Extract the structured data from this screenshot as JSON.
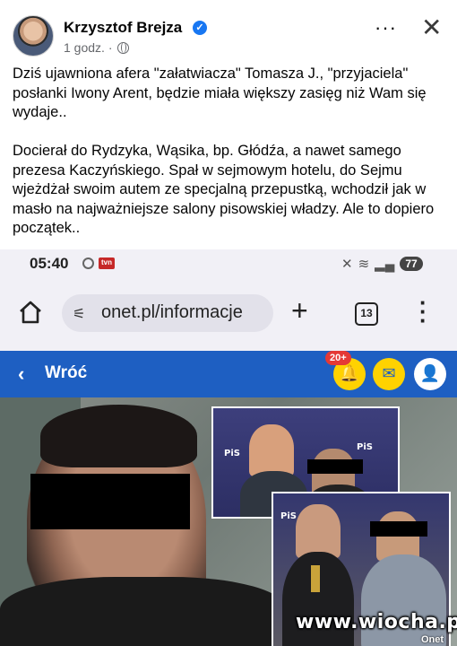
{
  "post": {
    "author": "Krzysztof Brejza",
    "time": "1 godz. ·",
    "more_label": "···",
    "close_label": "✕",
    "paragraphs": [
      "Dziś ujawniona afera \"załatwiacza\" Tomasza J., \"przyjaciela\" posłanki Iwony Arent, będzie miała większy zasięg niż Wam się wydaje..",
      "Docierał do Rydzyka, Wąsika, bp. Głódźa, a nawet samego prezesa Kaczyńskiego. Spał w sejmowym hotelu, do Sejmu wjeżdżał swoim autem ze specjalną przepustką, wchodził jak w masło na najważniejsze salony pisowskiej władzy. Ale to dopiero początek.."
    ]
  },
  "phone": {
    "status": {
      "time": "05:40",
      "battery": "77"
    },
    "browser": {
      "url": "onet.pl/informacje",
      "tab_count": "13"
    },
    "onet": {
      "back_label": "Wróć",
      "notif_badge": "20+"
    },
    "photo": {
      "logo_text": "PiS"
    }
  },
  "watermark": {
    "site": "www.wiocha.pl",
    "credit": "Onet"
  },
  "colors": {
    "facebook_blue": "#1877f2",
    "onet_blue": "#1e5fc2",
    "onet_yellow": "#ffd200"
  }
}
